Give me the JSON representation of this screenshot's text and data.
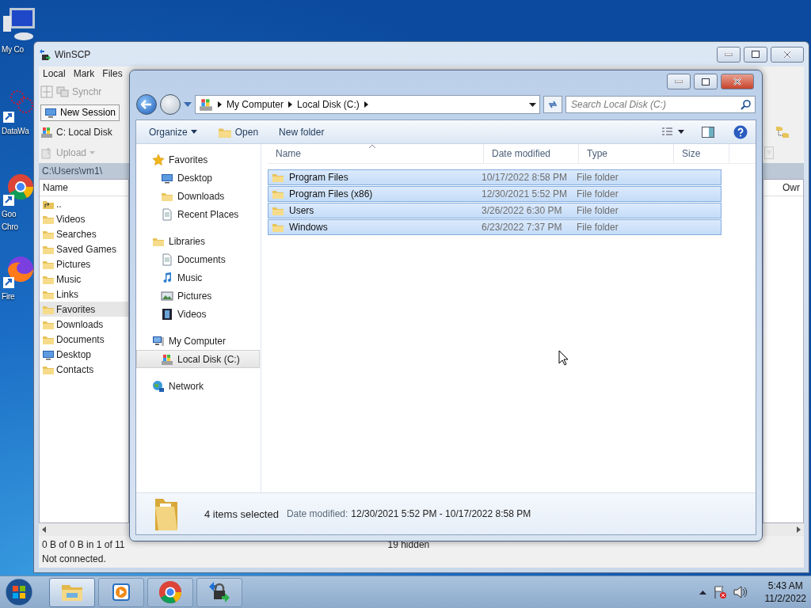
{
  "desktop": {
    "icons": [
      {
        "kind": "computer",
        "lines": [
          "My Co"
        ]
      },
      {
        "kind": "graph",
        "lines": [
          "DataWa"
        ]
      },
      {
        "kind": "chrome",
        "lines": [
          "Goo",
          "Chro"
        ]
      },
      {
        "kind": "firefox",
        "lines": [
          "Fire"
        ]
      }
    ]
  },
  "winscp": {
    "title": "WinSCP",
    "menu": [
      "Local",
      "Mark",
      "Files"
    ],
    "sync": "Synchr",
    "session_tab": "New Session",
    "drive": "C: Local Disk",
    "upload": "Upload",
    "path": "C:\\Users\\vm1\\",
    "column": "Name",
    "right_column": "Owr",
    "items": [
      {
        "name": "..",
        "kind": "up",
        "selected": false
      },
      {
        "name": "Videos",
        "kind": "folder",
        "selected": false
      },
      {
        "name": "Searches",
        "kind": "folder",
        "selected": false
      },
      {
        "name": "Saved Games",
        "kind": "folder",
        "selected": false
      },
      {
        "name": "Pictures",
        "kind": "folder",
        "selected": false
      },
      {
        "name": "Music",
        "kind": "folder",
        "selected": false
      },
      {
        "name": "Links",
        "kind": "folder",
        "selected": false
      },
      {
        "name": "Favorites",
        "kind": "folder",
        "selected": true
      },
      {
        "name": "Downloads",
        "kind": "folder",
        "selected": false
      },
      {
        "name": "Documents",
        "kind": "folder",
        "selected": false
      },
      {
        "name": "Desktop",
        "kind": "monitor",
        "selected": false
      },
      {
        "name": "Contacts",
        "kind": "folder",
        "selected": false
      }
    ],
    "status": "0 B of 0 B in 1 of 11",
    "hidden": "19 hidden",
    "connection": "Not connected."
  },
  "explorer": {
    "breadcrumbs": [
      "My Computer",
      "Local Disk (C:)"
    ],
    "search": {
      "placeholder": "Search Local Disk (C:)"
    },
    "commands": [
      {
        "label": "Organize",
        "kind": "menu"
      },
      {
        "label": "Open",
        "kind": "open"
      },
      {
        "label": "New folder",
        "kind": "plain"
      }
    ],
    "nav": [
      {
        "label": "Favorites",
        "kind": "star",
        "selected": false,
        "children": [
          {
            "label": "Desktop",
            "kind": "monitor",
            "selected": false
          },
          {
            "label": "Downloads",
            "kind": "folder",
            "selected": false
          },
          {
            "label": "Recent Places",
            "kind": "document",
            "selected": false
          }
        ]
      },
      {
        "label": "Libraries",
        "kind": "folder",
        "selected": false,
        "children": [
          {
            "label": "Documents",
            "kind": "document",
            "selected": false
          },
          {
            "label": "Music",
            "kind": "note",
            "selected": false
          },
          {
            "label": "Pictures",
            "kind": "image",
            "selected": false
          },
          {
            "label": "Videos",
            "kind": "film",
            "selected": false
          }
        ]
      },
      {
        "label": "My Computer",
        "kind": "computer",
        "selected": false,
        "children": [
          {
            "label": "Local Disk (C:)",
            "kind": "disk",
            "selected": true
          }
        ]
      },
      {
        "label": "Network",
        "kind": "globe",
        "selected": false
      }
    ],
    "columns": [
      "Name",
      "Date modified",
      "Type",
      "Size"
    ],
    "rows": [
      {
        "name": "Program Files",
        "date": "10/17/2022 8:58 PM",
        "type": "File folder",
        "selected": true
      },
      {
        "name": "Program Files (x86)",
        "date": "12/30/2021 5:52 PM",
        "type": "File folder",
        "selected": true
      },
      {
        "name": "Users",
        "date": "3/26/2022 6:30 PM",
        "type": "File folder",
        "selected": true
      },
      {
        "name": "Windows",
        "date": "6/23/2022 7:37 PM",
        "type": "File folder",
        "selected": true
      }
    ],
    "details": {
      "count": "4 items selected",
      "label": "Date modified:",
      "value": "12/30/2021 5:52 PM - 10/17/2022 8:58 PM"
    }
  },
  "taskbar": {
    "apps": [
      {
        "kind": "explorer",
        "selected": true
      },
      {
        "kind": "media",
        "selected": false
      },
      {
        "kind": "chrome",
        "selected": false
      },
      {
        "kind": "winscp",
        "selected": false
      }
    ],
    "time": "5:43 AM",
    "date": "11/2/2022"
  }
}
